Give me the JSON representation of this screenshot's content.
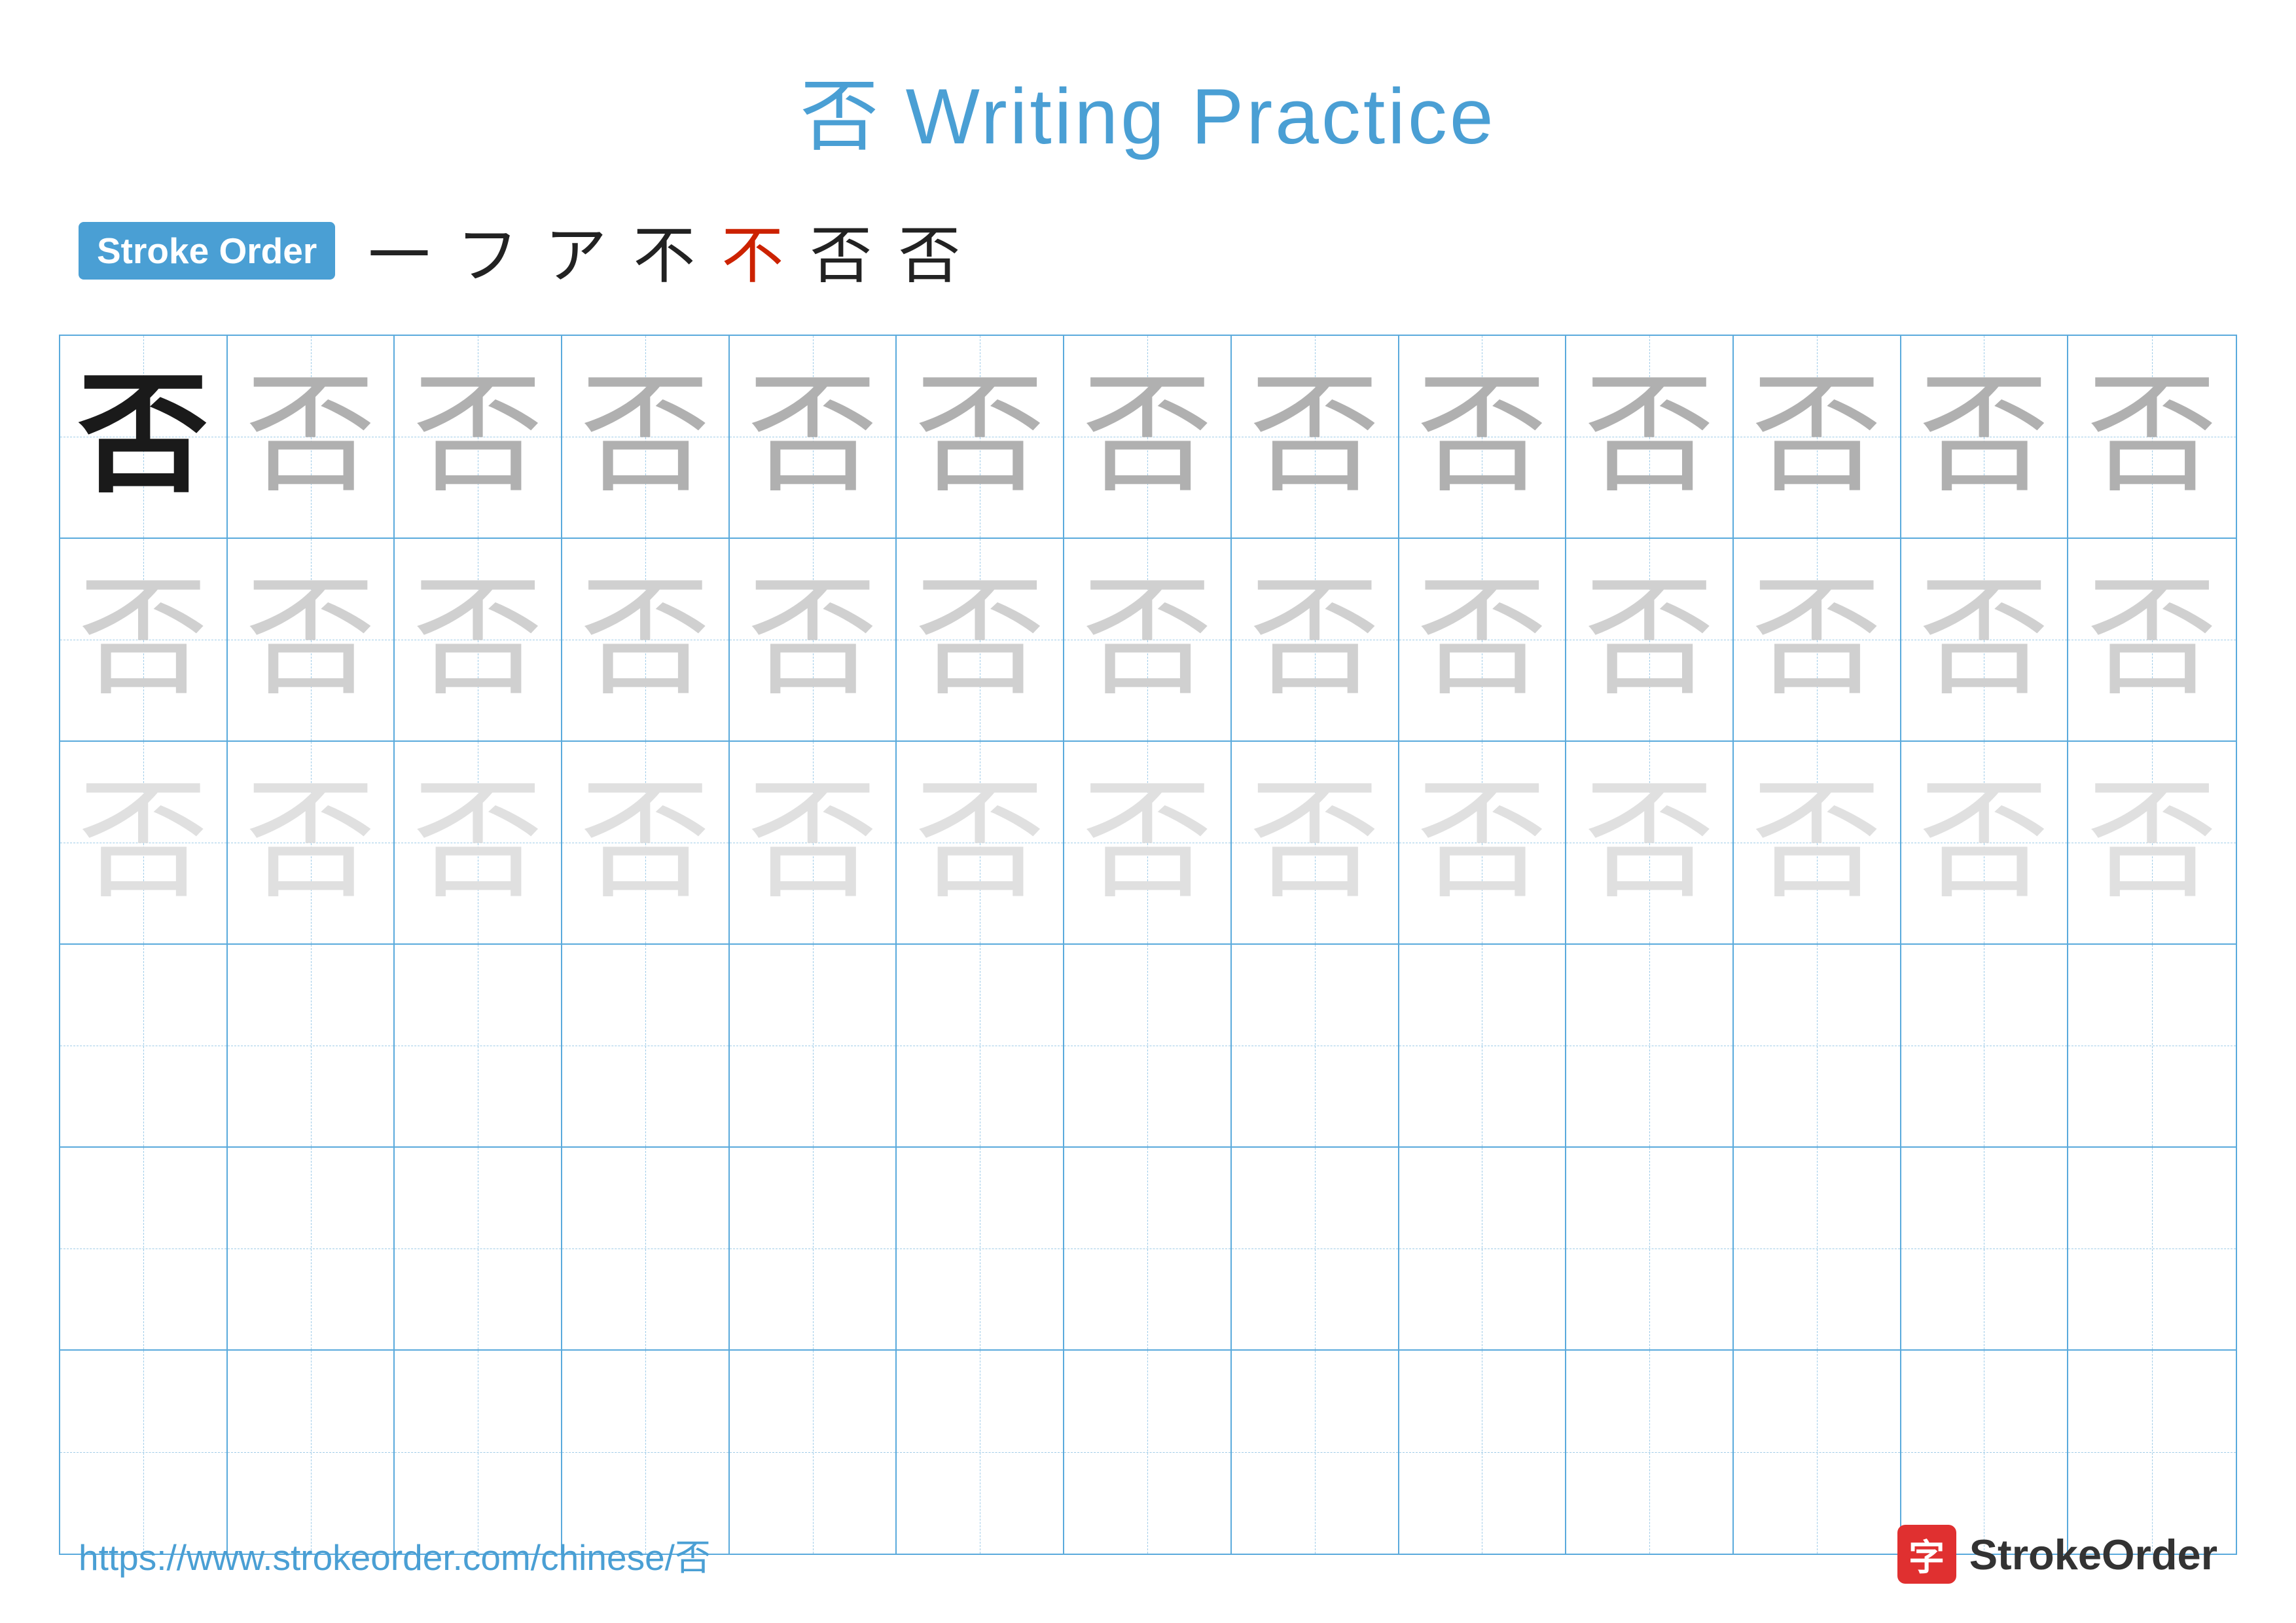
{
  "page": {
    "title": "否 Writing Practice",
    "title_char": "否",
    "title_text": " Writing Practice"
  },
  "stroke_order": {
    "badge_label": "Stroke Order",
    "strokes": [
      "一",
      "フ",
      "ア",
      "不",
      "不",
      "否",
      "否"
    ]
  },
  "grid": {
    "rows": 6,
    "cols": 13,
    "char": "否",
    "row_data": [
      [
        "dark",
        "medium-gray",
        "medium-gray",
        "medium-gray",
        "medium-gray",
        "medium-gray",
        "medium-gray",
        "medium-gray",
        "medium-gray",
        "medium-gray",
        "medium-gray",
        "medium-gray",
        "medium-gray"
      ],
      [
        "light-gray",
        "light-gray",
        "light-gray",
        "light-gray",
        "light-gray",
        "light-gray",
        "light-gray",
        "light-gray",
        "light-gray",
        "light-gray",
        "light-gray",
        "light-gray",
        "light-gray"
      ],
      [
        "very-light-gray",
        "very-light-gray",
        "very-light-gray",
        "very-light-gray",
        "very-light-gray",
        "very-light-gray",
        "very-light-gray",
        "very-light-gray",
        "very-light-gray",
        "very-light-gray",
        "very-light-gray",
        "very-light-gray",
        "very-light-gray"
      ],
      [
        "empty",
        "empty",
        "empty",
        "empty",
        "empty",
        "empty",
        "empty",
        "empty",
        "empty",
        "empty",
        "empty",
        "empty",
        "empty"
      ],
      [
        "empty",
        "empty",
        "empty",
        "empty",
        "empty",
        "empty",
        "empty",
        "empty",
        "empty",
        "empty",
        "empty",
        "empty",
        "empty"
      ],
      [
        "empty",
        "empty",
        "empty",
        "empty",
        "empty",
        "empty",
        "empty",
        "empty",
        "empty",
        "empty",
        "empty",
        "empty",
        "empty"
      ]
    ]
  },
  "footer": {
    "url": "https://www.strokeorder.com/chinese/否",
    "logo_char": "字",
    "logo_label": "StrokeOrder"
  }
}
